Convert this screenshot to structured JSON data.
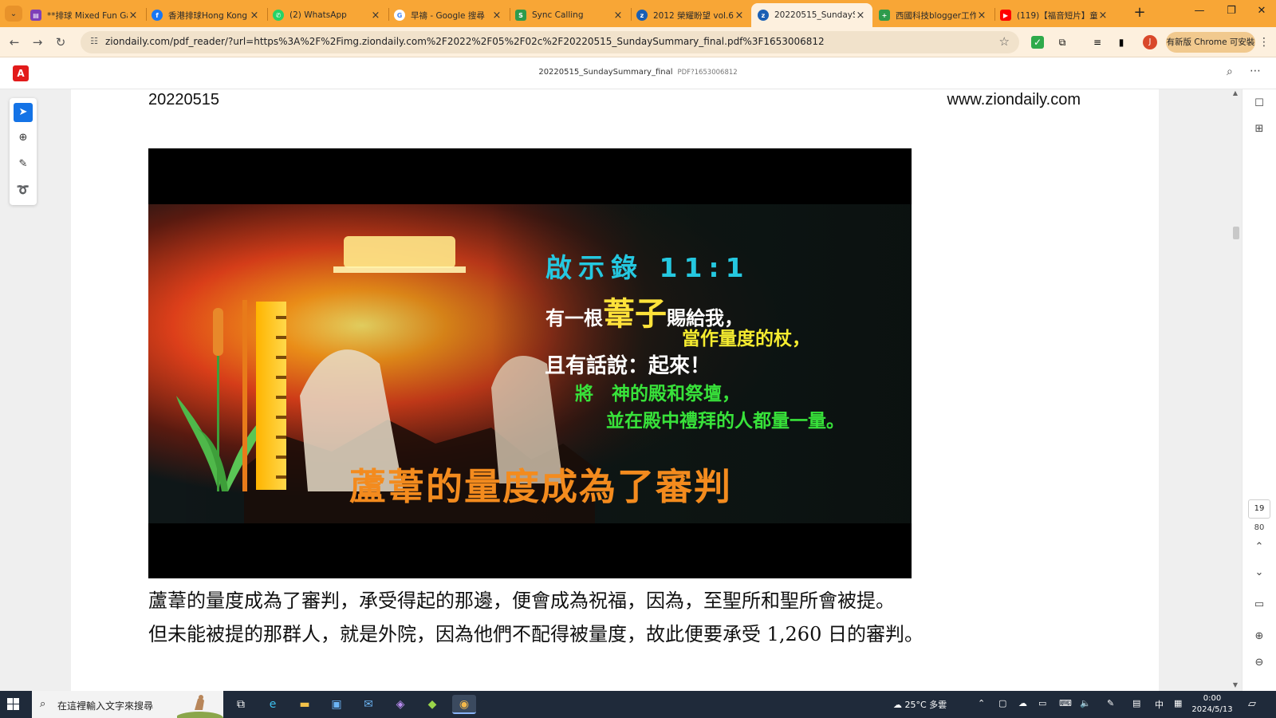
{
  "browser": {
    "tabs": [
      {
        "label": "**排球 Mixed Fun Ga",
        "favicon": "forms-icon",
        "color": "#7e3fb8"
      },
      {
        "label": "香港排球Hong Kong",
        "favicon": "facebook-icon",
        "color": "#1877f2"
      },
      {
        "label": "(2) WhatsApp",
        "favicon": "whatsapp-icon",
        "color": "#25d366"
      },
      {
        "label": "早禱 - Google 搜尋",
        "favicon": "google-icon",
        "color": "#4285f4"
      },
      {
        "label": "Sync Calling",
        "favicon": "sync-icon",
        "color": "#2e9b4c"
      },
      {
        "label": "2012 榮耀盼望 vol.6",
        "favicon": "zion-icon",
        "color": "#1a5fb4"
      },
      {
        "label": "20220515_SundayS",
        "favicon": "zion-icon",
        "color": "#1a5fb4",
        "active": true
      },
      {
        "label": "西國科技blogger工作",
        "favicon": "plus-icon",
        "color": "#2e9b4c"
      },
      {
        "label": "(119)【福音短片】童",
        "favicon": "youtube-icon",
        "color": "#ff0000"
      }
    ],
    "new_tab": "+",
    "url": "ziondaily.com/pdf_reader/?url=https%3A%2F%2Fimg.ziondaily.com%2F2022%2F05%2F02c%2F20220515_SundaySummary_final.pdf%3F1653006812",
    "update_button": "有新版 Chrome 可安裝",
    "profile_initial": "J",
    "accent": "#f8a636"
  },
  "viewer": {
    "title": "20220515_SundaySummary_final",
    "subtitle": "PDF?1653006812",
    "current_page": "19",
    "total_pages": "80"
  },
  "page": {
    "header_date": "20220515",
    "header_site": "www.ziondaily.com",
    "slide": {
      "title": "啟示錄 11:1",
      "line1_pre": "有一根",
      "line1_big": "葦子",
      "line1_post": "賜給我，",
      "line2": "當作量度的杖，",
      "line3": "且有話說：起來！",
      "line4": "將　神的殿和祭壇，",
      "line5": "並在殿中禮拜的人都量一量。",
      "banner": "蘆葦的量度成為了審判"
    },
    "body_lines": [
      "蘆葦的量度成為了審判，承受得起的那邊，便會成為祝福，因為，至聖所和聖所會被提。",
      "但未能被提的那群人，就是外院，因為他們不配得被量度，故此便要承受 1,260 日的審判。"
    ]
  },
  "taskbar": {
    "search_placeholder": "在這裡輸入文字來搜尋",
    "weather": "25°C  多雲",
    "ime": "中",
    "time": "0:00",
    "date": "2024/5/13"
  }
}
